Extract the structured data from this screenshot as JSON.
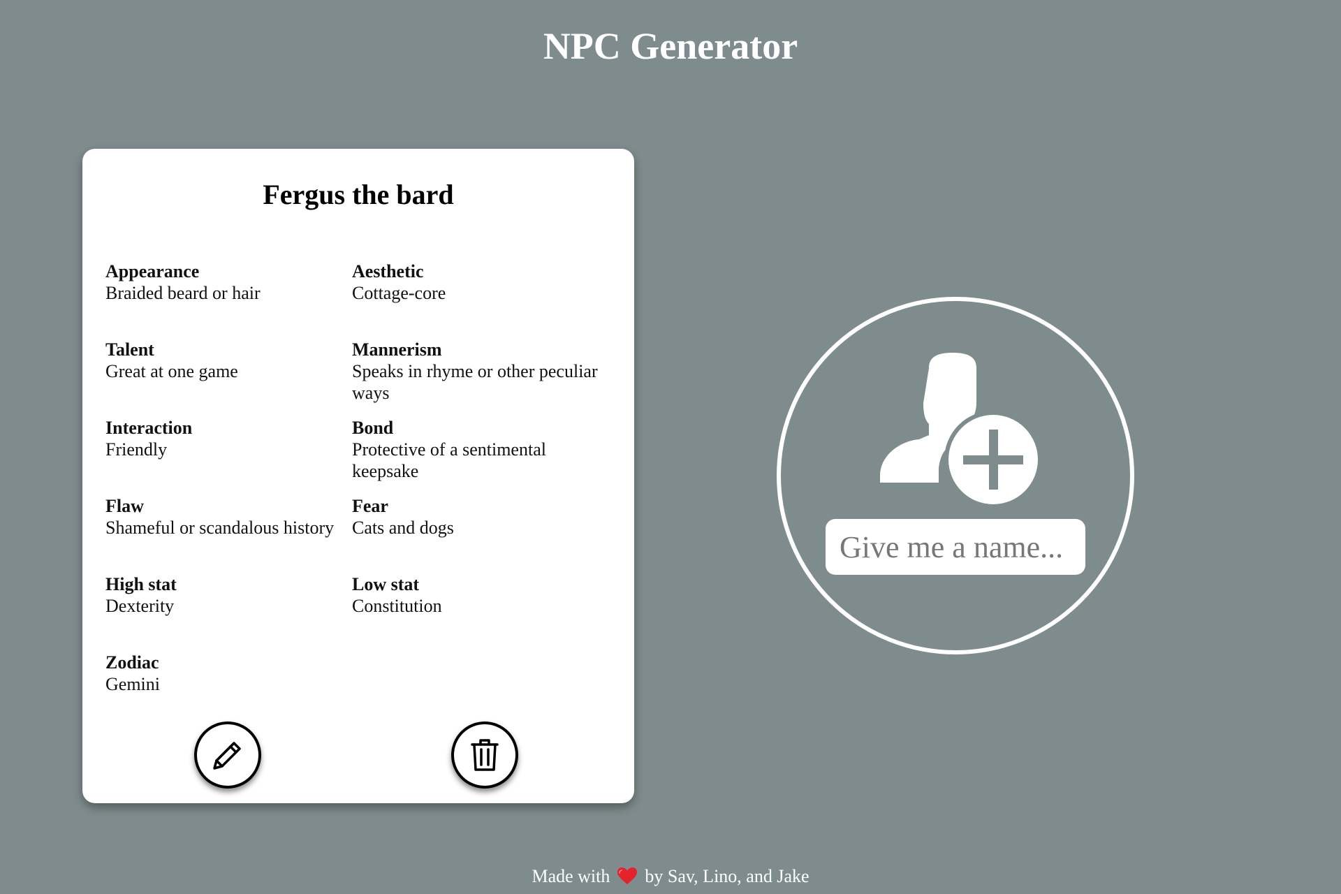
{
  "header": {
    "title": "NPC Generator"
  },
  "npc_card": {
    "name": "Fergus the bard",
    "attributes": [
      {
        "label": "Appearance",
        "value": "Braided beard or hair"
      },
      {
        "label": "Aesthetic",
        "value": "Cottage-core"
      },
      {
        "label": "Talent",
        "value": "Great at one game"
      },
      {
        "label": "Mannerism",
        "value": "Speaks in rhyme or other peculiar ways"
      },
      {
        "label": "Interaction",
        "value": "Friendly"
      },
      {
        "label": "Bond",
        "value": "Protective of a sentimental keepsake"
      },
      {
        "label": "Flaw",
        "value": "Shameful or scandalous history"
      },
      {
        "label": "Fear",
        "value": "Cats and dogs"
      },
      {
        "label": "High stat",
        "value": "Dexterity"
      },
      {
        "label": "Low stat",
        "value": "Constitution"
      },
      {
        "label": "Zodiac",
        "value": "Gemini"
      }
    ],
    "edit_icon": "pencil-icon",
    "delete_icon": "trash-icon"
  },
  "new_npc": {
    "icon": "add-user-icon",
    "placeholder": "Give me a name..."
  },
  "footer": {
    "prefix": "Made with",
    "icon": "heart-icon",
    "suffix": "by Sav, Lino, and Jake"
  },
  "colors": {
    "background": "#7f8c8d",
    "card": "#ffffff",
    "heart": "#e3222b"
  }
}
